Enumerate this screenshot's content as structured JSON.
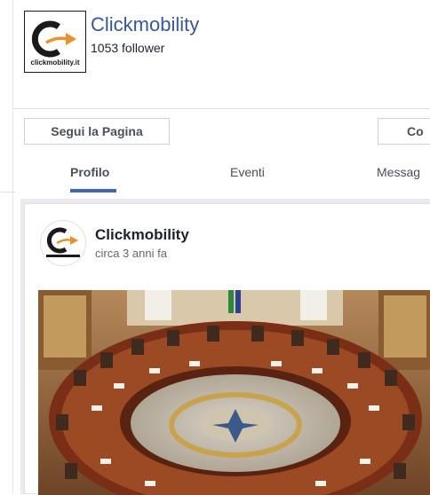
{
  "header": {
    "page_name": "Clickmobility",
    "followers": "1053 follower",
    "logo_text": "clickmobility.it"
  },
  "actions": {
    "follow_label": "Segui la Pagina",
    "contact_label": "Co"
  },
  "tabs": [
    {
      "label": "Profilo",
      "active": true
    },
    {
      "label": "Eventi",
      "active": false
    },
    {
      "label": "Messag",
      "active": false
    }
  ],
  "post": {
    "author": "Clickmobility",
    "time": "circa 3 anni fa",
    "image_subject": "round-council-table-photo"
  },
  "colors": {
    "link_blue": "#365899",
    "tab_accent": "#4267b2",
    "logo_orange": "#e8922a",
    "feed_bg": "#e9ebee"
  }
}
